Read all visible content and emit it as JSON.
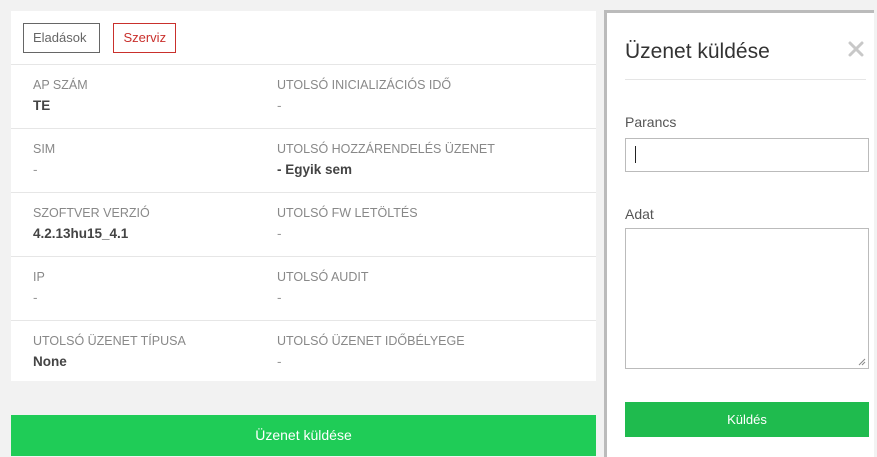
{
  "tabs": {
    "sales_label": "Eladások",
    "service_label": "Szerviz"
  },
  "rows": [
    {
      "left_label": "AP SZÁM",
      "left_value": "TE",
      "right_label": "UTOLSÓ INICIALIZÁCIÓS IDŐ",
      "right_value": "-"
    },
    {
      "left_label": "SIM",
      "left_value": "-",
      "right_label": "UTOLSÓ HOZZÁRENDELÉS ÜZENET",
      "right_value": "- Egyik sem"
    },
    {
      "left_label": "SZOFTVER VERZIÓ",
      "left_value": "4.2.13hu15_4.1",
      "right_label": "UTOLSÓ FW LETÖLTÉS",
      "right_value": "-"
    },
    {
      "left_label": "IP",
      "left_value": "-",
      "right_label": "UTOLSÓ AUDIT",
      "right_value": "-"
    },
    {
      "left_label": "UTOLSÓ ÜZENET TÍPUSA",
      "left_value": "None",
      "right_label": "UTOLSÓ ÜZENET IDŐBÉLYEGE",
      "right_value": "-"
    }
  ],
  "main_button_label": "Üzenet küldése",
  "modal": {
    "title": "Üzenet küldése",
    "close_icon": "close-icon",
    "command_label": "Parancs",
    "command_value": "",
    "data_label": "Adat",
    "data_value": "",
    "send_label": "Küldés"
  },
  "colors": {
    "accent_green": "#1fcc57",
    "service_red": "#c9302c"
  }
}
